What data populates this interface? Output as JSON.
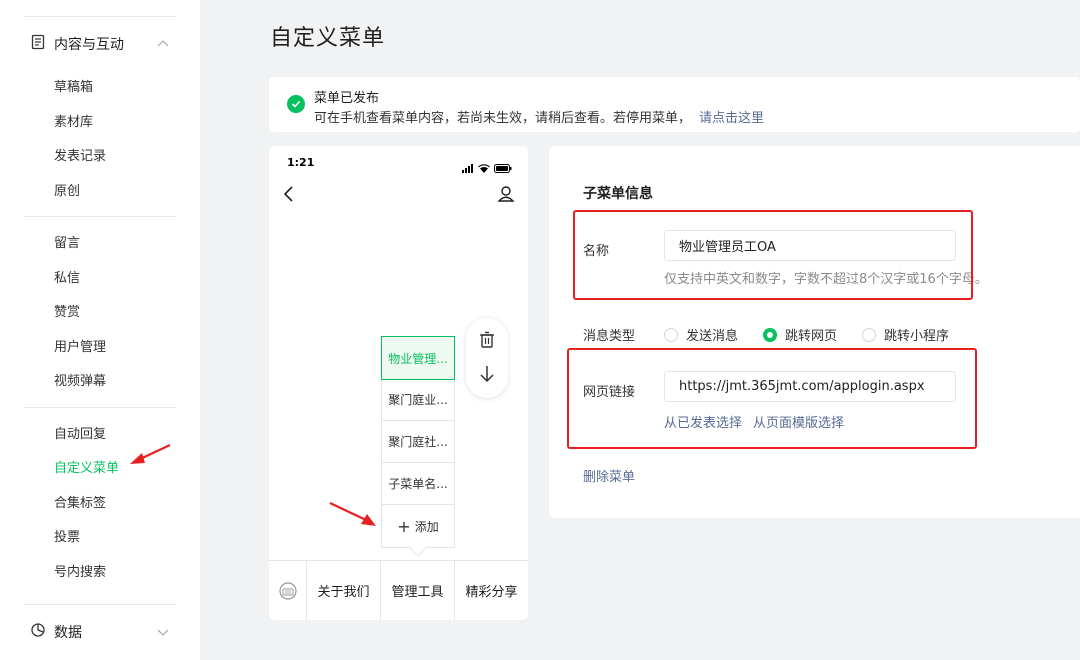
{
  "sidebar": {
    "section_content": "内容与互动",
    "items_group1": [
      "草稿箱",
      "素材库",
      "发表记录",
      "原创"
    ],
    "items_group2": [
      "留言",
      "私信",
      "赞赏",
      "用户管理",
      "视频弹幕"
    ],
    "items_group3": [
      "自动回复",
      "自定义菜单",
      "合集标签",
      "投票",
      "号内搜索"
    ],
    "active_item": "自定义菜单",
    "section_data": "数据"
  },
  "page": {
    "title": "自定义菜单"
  },
  "notice": {
    "title": "菜单已发布",
    "text": "可在手机查看菜单内容，若尚未生效，请稍后查看。若停用菜单，",
    "link": "请点击这里"
  },
  "phone": {
    "time": "1:21",
    "submenu": [
      "物业管理...",
      "聚门庭业...",
      "聚门庭社...",
      "子菜单名..."
    ],
    "add_label": "添加",
    "menubar": [
      "关于我们",
      "管理工具",
      "精彩分享"
    ]
  },
  "form": {
    "title": "子菜单信息",
    "name_label": "名称",
    "name_value": "物业管理员工OA",
    "name_hint": "仅支持中英文和数字，字数不超过8个汉字或16个字母。",
    "msg_type_label": "消息类型",
    "msg_types": [
      "发送消息",
      "跳转网页",
      "跳转小程序"
    ],
    "msg_type_selected": "跳转网页",
    "url_label": "网页链接",
    "url_value": "https://jmt.365jmt.com/applogin.aspx",
    "select_published": "从已发表选择",
    "select_template": "从页面模版选择",
    "delete_menu": "删除菜单"
  },
  "colors": {
    "accent": "#07c160",
    "link": "#576b95",
    "annotation": "#e62020"
  }
}
